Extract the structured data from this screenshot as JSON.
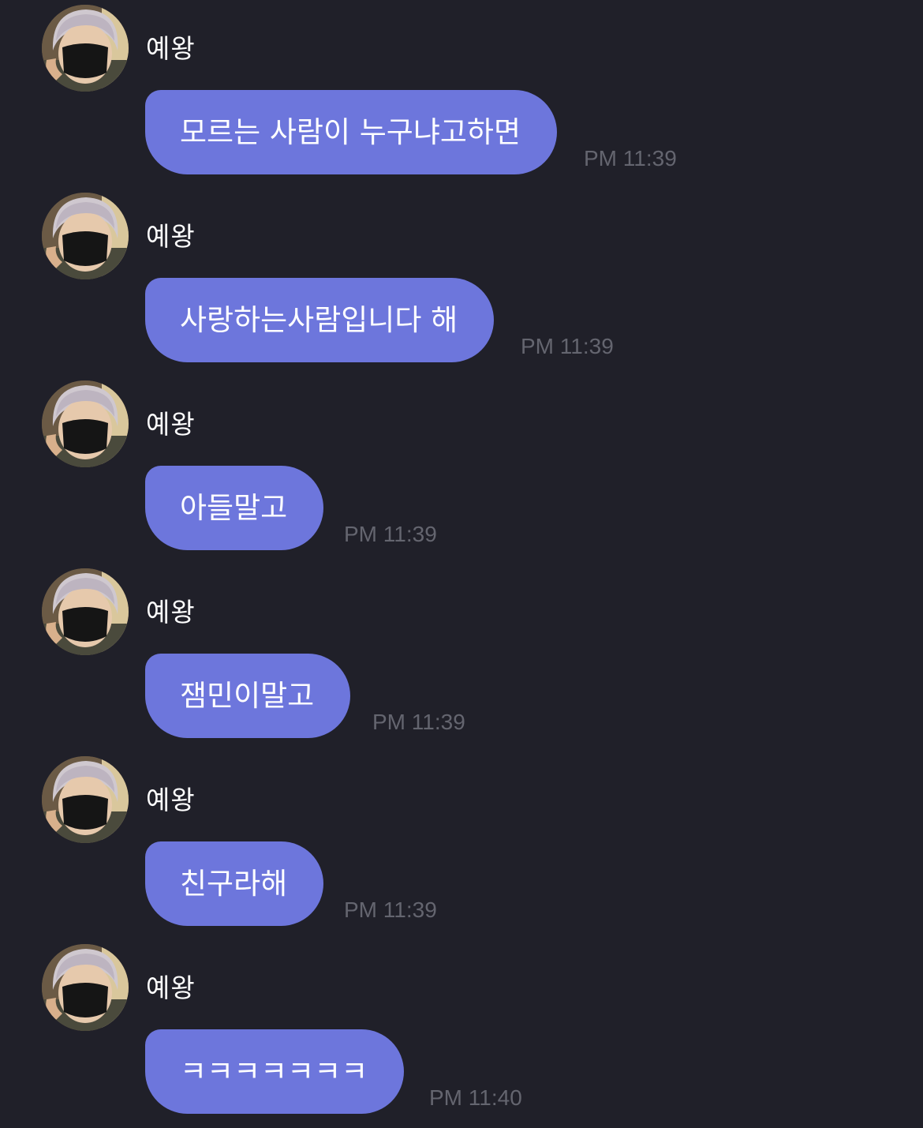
{
  "chat": {
    "messages": [
      {
        "sender": "예왕",
        "text": "모르는 사람이 누구냐고하면",
        "time": "PM 11:39"
      },
      {
        "sender": "예왕",
        "text": "사랑하는사람입니다 해",
        "time": "PM 11:39"
      },
      {
        "sender": "예왕",
        "text": "아들말고",
        "time": "PM 11:39"
      },
      {
        "sender": "예왕",
        "text": "잼민이말고",
        "time": "PM 11:39"
      },
      {
        "sender": "예왕",
        "text": "친구라해",
        "time": "PM 11:39"
      },
      {
        "sender": "예왕",
        "text": "ㅋㅋㅋㅋㅋㅋㅋ",
        "time": "PM 11:40"
      }
    ]
  },
  "colors": {
    "background": "#202029",
    "bubble": "#6d76dc",
    "timestamp": "#64656f",
    "text": "#ffffff"
  },
  "icons": {
    "avatar": "profile-photo-masked-person"
  }
}
